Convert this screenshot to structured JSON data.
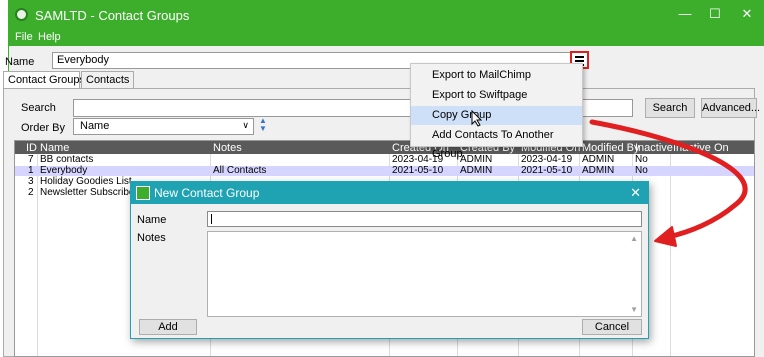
{
  "window": {
    "title": "SAMLTD - Contact Groups",
    "minimize": "—",
    "maximize": "☐",
    "close": "✕",
    "accent": "#3dae2b"
  },
  "menubar": {
    "file": "File",
    "help": "Help"
  },
  "name_row": {
    "label": "Name",
    "value": "Everybody"
  },
  "tabs": [
    "Contact Groups",
    "Contacts"
  ],
  "search": {
    "label": "Search",
    "button": "Search",
    "advanced": "Advanced..."
  },
  "order_by": {
    "label": "Order By",
    "value": "Name"
  },
  "grid": {
    "columns": [
      "ID",
      "Name",
      "Notes",
      "Created On",
      "Created By",
      "Modified On",
      "Modified By",
      "Inactive",
      "Inactive On"
    ],
    "rows": [
      {
        "id": "7",
        "name": "BB contacts",
        "notes": "",
        "created_on": "2023-04-19",
        "created_by": "ADMIN",
        "modified_on": "2023-04-19",
        "modified_by": "ADMIN",
        "inactive": "No",
        "selected": false
      },
      {
        "id": "1",
        "name": "Everybody",
        "notes": "All Contacts",
        "created_on": "2021-05-10",
        "created_by": "ADMIN",
        "modified_on": "2021-05-10",
        "modified_by": "ADMIN",
        "inactive": "No",
        "selected": true
      },
      {
        "id": "3",
        "name": "Holiday Goodies List",
        "notes": "",
        "selected": false
      },
      {
        "id": "2",
        "name": "Newsletter Subscribers",
        "notes": "",
        "selected": false
      }
    ]
  },
  "popup_menu": {
    "items": [
      "Export to MailChimp",
      "Export to Swiftpage",
      "Copy Group",
      "Add Contacts To Another Group"
    ],
    "highlighted_index": 2
  },
  "dialog": {
    "title": "New Contact Group",
    "close": "✕",
    "name_label": "Name",
    "name_value": "",
    "notes_label": "Notes",
    "notes_value": "",
    "add_button": "Add",
    "cancel_button": "Cancel",
    "accent": "#1fa2b1"
  },
  "annotation": {
    "arrow_color": "#e02020"
  }
}
